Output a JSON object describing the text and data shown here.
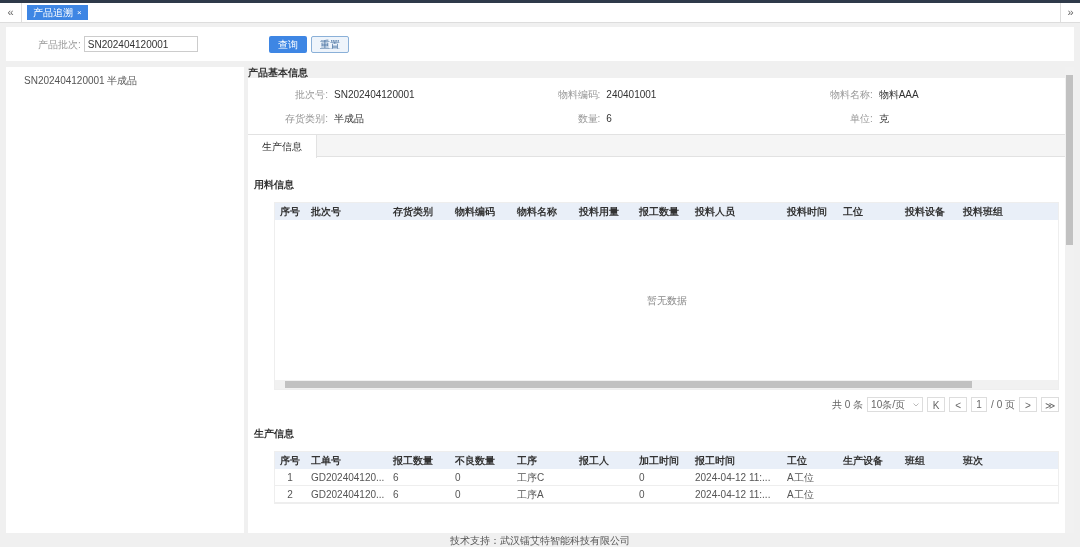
{
  "tabs": [
    {
      "label": "产品追溯",
      "close": "×",
      "selected": true
    }
  ],
  "nav": {
    "left": "«",
    "right": "»"
  },
  "search": {
    "label": "产品批次:",
    "value": "SN202404120001",
    "buttons": [
      {
        "label": "查询",
        "kind": "primary"
      },
      {
        "label": "重置",
        "kind": "plain"
      }
    ]
  },
  "tree": {
    "items": [
      {
        "label": "SN202404120001 半成品",
        "selected": false
      }
    ]
  },
  "basic_info": {
    "title": "产品基本信息",
    "fields": [
      {
        "label": "批次号:",
        "value": "SN202404120001"
      },
      {
        "label": "物料编码:",
        "value": "240401001"
      },
      {
        "label": "物料名称:",
        "value": "物料AAA"
      },
      {
        "label": "存货类别:",
        "value": "半成品"
      },
      {
        "label": "数量:",
        "value": "6"
      },
      {
        "label": "单位:",
        "value": "克"
      }
    ]
  },
  "detail_tabs": [
    {
      "label": "生产信息",
      "selected": true
    }
  ],
  "material_table": {
    "title": "用料信息",
    "columns": [
      "序号",
      "批次号",
      "存货类别",
      "物料编码",
      "物料名称",
      "投料用量",
      "报工数量",
      "投料人员",
      "投料时间",
      "工位",
      "投料设备",
      "投料班组"
    ],
    "empty": "暂无数据"
  },
  "pagination": {
    "total": "共 0 条",
    "page_size": "10条/页",
    "first": "K",
    "prev": "<",
    "page": "1",
    "pages": "/ 0 页",
    "next": ">",
    "last": "≫"
  },
  "production_table": {
    "title": "生产信息",
    "columns": [
      "序号",
      "工单号",
      "报工数量",
      "不良数量",
      "工序",
      "报工人",
      "加工时间",
      "报工时间",
      "工位",
      "生产设备",
      "班组",
      "班次"
    ],
    "rows": [
      [
        "1",
        "GD202404120...",
        "6",
        "0",
        "工序C",
        "",
        "0",
        "2024-04-12 11:...",
        "A工位",
        "",
        "",
        ""
      ],
      [
        "2",
        "GD202404120...",
        "6",
        "0",
        "工序A",
        "",
        "0",
        "2024-04-12 11:...",
        "A工位",
        "",
        "",
        ""
      ]
    ]
  },
  "footer": "技术支持：武汉镭艾特智能科技有限公司"
}
